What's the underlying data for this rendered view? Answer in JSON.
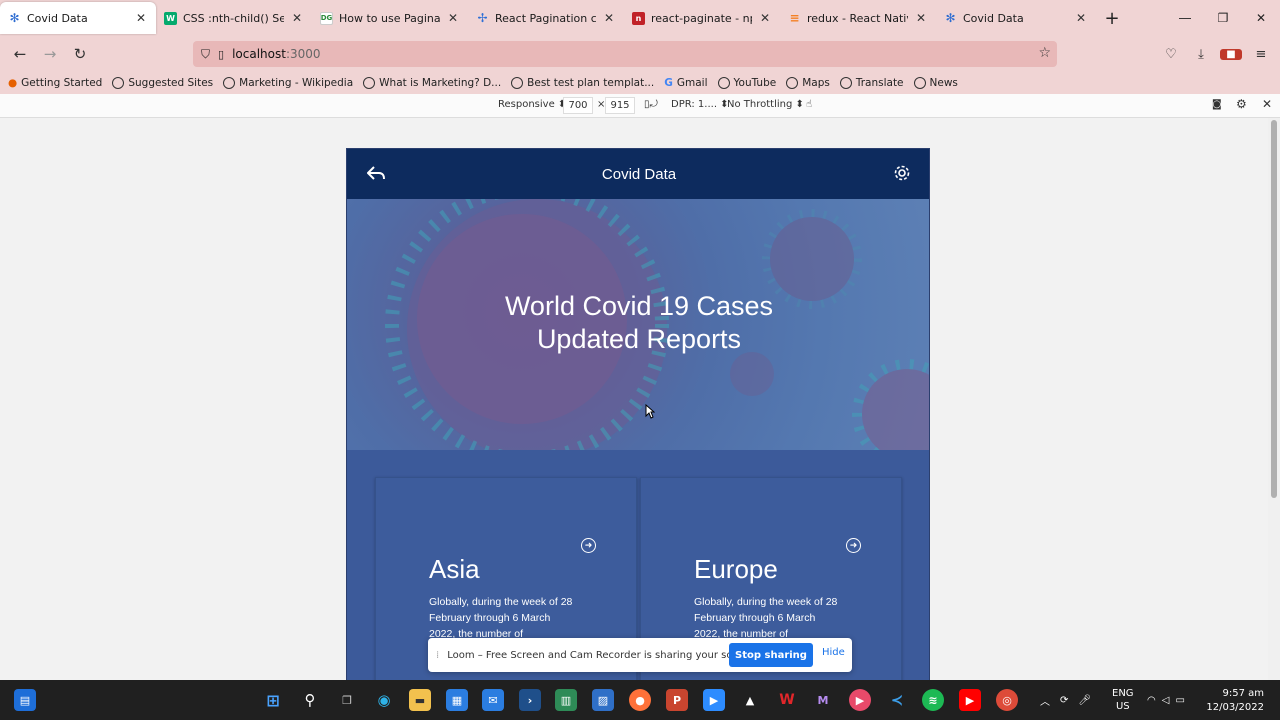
{
  "browser": {
    "tabs": [
      {
        "title": "Covid Data",
        "favicon": "gear-icon",
        "active": true
      },
      {
        "title": "CSS :nth-child() Selector",
        "favicon": "w-icon",
        "active": false
      },
      {
        "title": "How to use Pagination C",
        "favicon": "dg-icon",
        "active": false
      },
      {
        "title": "React Pagination compo",
        "favicon": "react-icon",
        "active": false
      },
      {
        "title": "react-paginate - npm",
        "favicon": "npm-icon",
        "active": false
      },
      {
        "title": "redux - React Native: co",
        "favicon": "stack-icon",
        "active": false
      },
      {
        "title": "Covid Data",
        "favicon": "gear-icon",
        "active": false
      }
    ],
    "url": {
      "host": "localhost",
      "port": ":3000"
    },
    "bookmarks": [
      "Getting Started",
      "Suggested Sites",
      "Marketing - Wikipedia",
      "What is Marketing? D...",
      "Best test plan templat...",
      "Gmail",
      "YouTube",
      "Maps",
      "Translate",
      "News"
    ]
  },
  "devtools": {
    "mode": "Responsive",
    "width": "700",
    "sep": "×",
    "height": "915",
    "dpr": "DPR: 1....",
    "throttle": "No Throttling"
  },
  "app": {
    "header_title": "Covid Data",
    "hero_line1": "World Covid 19 Cases",
    "hero_line2": "Updated Reports",
    "cards": [
      {
        "name": "Asia",
        "desc": "Globally, during the week of 28 February through 6 March 2022, the number of"
      },
      {
        "name": "Europe",
        "desc": "Globally, during the week of 28 February through 6 March 2022, the number of"
      }
    ]
  },
  "loom": {
    "message": "Loom – Free Screen and Cam Recorder is sharing your screen.",
    "stop_label": "Stop sharing",
    "hide_label": "Hide"
  },
  "taskbar": {
    "lang_top": "ENG",
    "lang_bottom": "US",
    "time": "9:57 am",
    "date": "12/03/2022"
  },
  "colors": {
    "app_header": "#0d2b5e",
    "app_body": "#3c5a9a",
    "browser_chrome": "#f0d4d4",
    "loom_button": "#1a73e8"
  }
}
